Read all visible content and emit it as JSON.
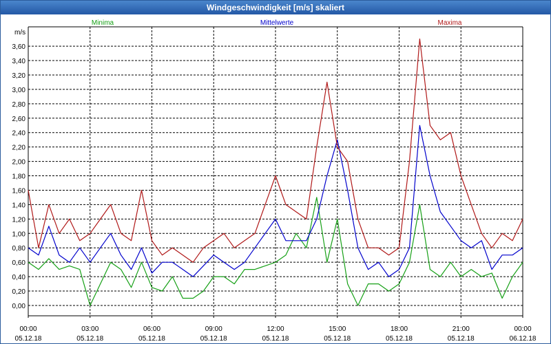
{
  "window": {
    "title": "Windgeschwindigkeit [m/s] skaliert"
  },
  "chart_data": {
    "type": "line",
    "title": "Windgeschwindigkeit [m/s] skaliert",
    "ylabel": "m/s",
    "ylim": [
      0,
      3.6
    ],
    "y_ticks": [
      "0,00",
      "0,20",
      "0,40",
      "0,60",
      "0,80",
      "1,00",
      "1,20",
      "1,40",
      "1,60",
      "1,80",
      "2,00",
      "2,20",
      "2,40",
      "2,60",
      "2,80",
      "3,00",
      "3,20",
      "3,40",
      "3,60"
    ],
    "x_ticks": [
      {
        "time": "00:00",
        "date": "05.12.18"
      },
      {
        "time": "03:00",
        "date": "05.12.18"
      },
      {
        "time": "06:00",
        "date": "05.12.18"
      },
      {
        "time": "09:00",
        "date": "05.12.18"
      },
      {
        "time": "12:00",
        "date": "05.12.18"
      },
      {
        "time": "15:00",
        "date": "05.12.18"
      },
      {
        "time": "18:00",
        "date": "05.12.18"
      },
      {
        "time": "21:00",
        "date": "05.12.18"
      },
      {
        "time": "00:00",
        "date": "06.12.18"
      }
    ],
    "grid": true,
    "legend_position": "top",
    "x_hours": [
      0,
      0.5,
      1,
      1.5,
      2,
      2.5,
      3,
      3.5,
      4,
      4.5,
      5,
      5.5,
      6,
      6.5,
      7,
      7.5,
      8,
      8.5,
      9,
      9.5,
      10,
      10.5,
      11,
      11.5,
      12,
      12.5,
      13,
      13.5,
      14,
      14.5,
      15,
      15.5,
      16,
      16.5,
      17,
      17.5,
      18,
      18.5,
      19,
      19.5,
      20,
      20.5,
      21,
      21.5,
      22,
      22.5,
      23,
      23.5,
      24
    ],
    "series": [
      {
        "name": "Minima",
        "color": "#16a016",
        "values": [
          0.6,
          0.5,
          0.65,
          0.5,
          0.55,
          0.5,
          0.0,
          0.3,
          0.6,
          0.5,
          0.25,
          0.6,
          0.25,
          0.2,
          0.4,
          0.1,
          0.1,
          0.2,
          0.4,
          0.4,
          0.3,
          0.5,
          0.5,
          0.55,
          0.6,
          0.7,
          1.0,
          0.8,
          1.5,
          0.6,
          1.2,
          0.3,
          0.0,
          0.3,
          0.3,
          0.2,
          0.3,
          0.6,
          1.4,
          0.5,
          0.4,
          0.6,
          0.4,
          0.5,
          0.4,
          0.45,
          0.1,
          0.4,
          0.6
        ]
      },
      {
        "name": "Mittelwerte",
        "color": "#0000cc",
        "values": [
          0.8,
          0.7,
          1.1,
          0.7,
          0.6,
          0.8,
          0.6,
          0.8,
          1.0,
          0.7,
          0.5,
          0.8,
          0.45,
          0.6,
          0.6,
          0.5,
          0.4,
          0.55,
          0.7,
          0.6,
          0.5,
          0.6,
          0.8,
          1.0,
          1.2,
          0.9,
          0.9,
          0.9,
          1.2,
          1.8,
          2.3,
          1.6,
          0.8,
          0.5,
          0.6,
          0.4,
          0.5,
          0.8,
          2.5,
          1.8,
          1.3,
          1.1,
          0.9,
          0.8,
          0.9,
          0.5,
          0.7,
          0.7,
          0.8
        ]
      },
      {
        "name": "Maxima",
        "color": "#b01818",
        "values": [
          1.6,
          0.8,
          1.4,
          1.0,
          1.2,
          0.9,
          1.0,
          1.2,
          1.4,
          1.0,
          0.9,
          1.6,
          0.9,
          0.7,
          0.8,
          0.7,
          0.6,
          0.8,
          0.9,
          1.0,
          0.8,
          0.9,
          1.0,
          1.4,
          1.8,
          1.4,
          1.3,
          1.2,
          2.2,
          3.1,
          2.2,
          2.0,
          1.2,
          0.8,
          0.8,
          0.7,
          0.8,
          2.0,
          3.7,
          2.5,
          2.3,
          2.4,
          1.8,
          1.4,
          1.0,
          0.8,
          1.0,
          0.9,
          1.2
        ]
      }
    ]
  }
}
